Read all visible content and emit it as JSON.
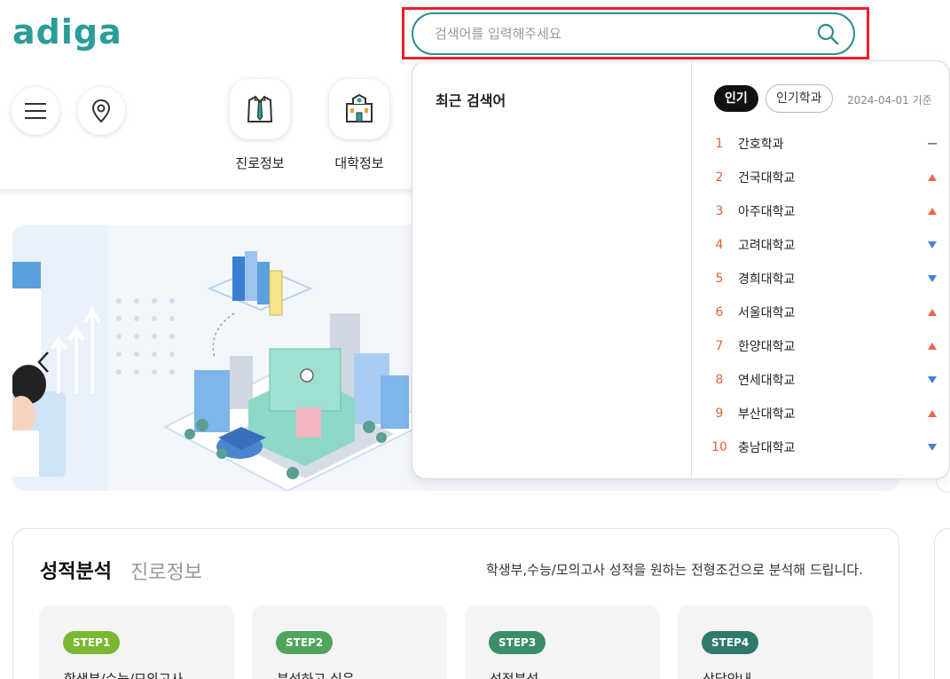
{
  "header": {
    "logo": "adiga",
    "categories": [
      {
        "label": "진로정보",
        "icon": "shirt-tie-icon"
      },
      {
        "label": "대학정보",
        "icon": "university-building-icon"
      }
    ]
  },
  "search": {
    "placeholder": "검색어를 입력해주세요",
    "value": ""
  },
  "dropdown": {
    "recent_title": "최근 검색어",
    "tabs": [
      {
        "label": "인기",
        "active": true
      },
      {
        "label": "인기학과",
        "active": false
      }
    ],
    "date": "2024-04-01 기준",
    "rankings": [
      {
        "rank": "1",
        "name": "간호학과",
        "trend": "same"
      },
      {
        "rank": "2",
        "name": "건국대학교",
        "trend": "up"
      },
      {
        "rank": "3",
        "name": "아주대학교",
        "trend": "up"
      },
      {
        "rank": "4",
        "name": "고려대학교",
        "trend": "down"
      },
      {
        "rank": "5",
        "name": "경희대학교",
        "trend": "down"
      },
      {
        "rank": "6",
        "name": "서울대학교",
        "trend": "up"
      },
      {
        "rank": "7",
        "name": "한양대학교",
        "trend": "up"
      },
      {
        "rank": "8",
        "name": "연세대학교",
        "trend": "down"
      },
      {
        "rank": "9",
        "name": "부산대학교",
        "trend": "up"
      },
      {
        "rank": "10",
        "name": "충남대학교",
        "trend": "down"
      }
    ]
  },
  "colors": {
    "brand": "#2a9d9a",
    "highlight": "#e8202a",
    "trend_up": "#e86a4a",
    "trend_down": "#4a7fd6",
    "step_colors": [
      "#7ab832",
      "#4fa65a",
      "#3a8f6a",
      "#2f7a6d"
    ]
  },
  "score": {
    "title": "성적분석",
    "subtitle": "진로정보",
    "description": "학생부,수능/모의고사 성적을 원하는 전형조건으로 분석해 드립니다.",
    "steps": [
      {
        "badge": "STEP1",
        "text": "학생부/수능/모의고사"
      },
      {
        "badge": "STEP2",
        "text": "분석하고 싶은"
      },
      {
        "badge": "STEP3",
        "text": "성적분석"
      },
      {
        "badge": "STEP4",
        "text": "상담안내"
      }
    ]
  }
}
